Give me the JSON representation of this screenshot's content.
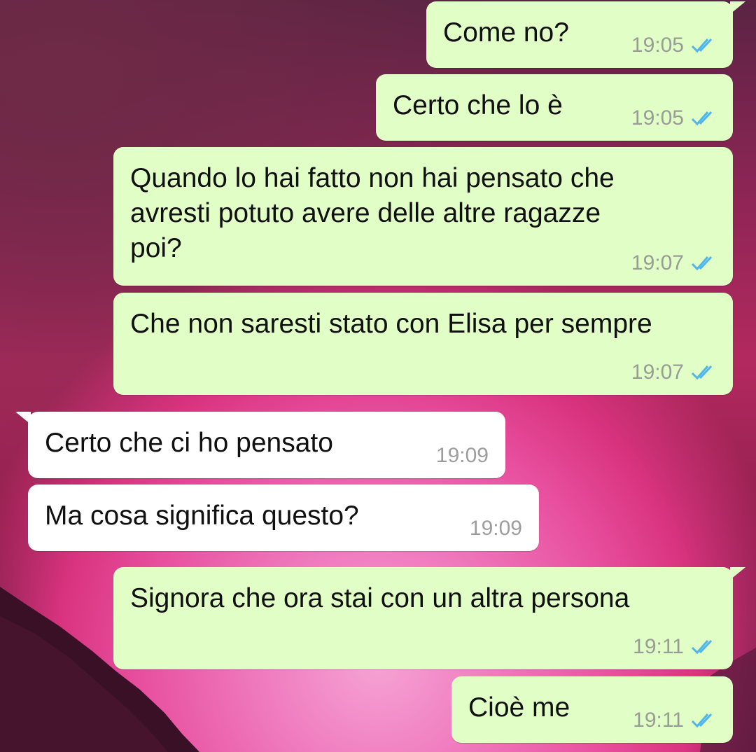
{
  "colors": {
    "outgoing_bubble": "#e1fec7",
    "incoming_bubble": "#ffffff",
    "read_ticks": "#4fb6ec",
    "time_text": "#979d95"
  },
  "messages": [
    {
      "direction": "outgoing",
      "text": "Come no?",
      "time": "19:05",
      "status_icon": "double-check-read-icon"
    },
    {
      "direction": "outgoing",
      "text": "Certo che lo è",
      "time": "19:05",
      "status_icon": "double-check-read-icon"
    },
    {
      "direction": "outgoing",
      "text": "Quando lo hai fatto non hai pensato che\navresti potuto avere delle altre ragazze\npoi?",
      "time": "19:07",
      "status_icon": "double-check-read-icon"
    },
    {
      "direction": "outgoing",
      "text": "Che non saresti stato con Elisa per sempre",
      "time": "19:07",
      "status_icon": "double-check-read-icon"
    },
    {
      "direction": "incoming",
      "text": "Certo che ci ho pensato",
      "time": "19:09"
    },
    {
      "direction": "incoming",
      "text": "Ma cosa significa questo?",
      "time": "19:09"
    },
    {
      "direction": "outgoing",
      "text": "Signora che ora stai con un altra persona",
      "time": "19:11",
      "status_icon": "double-check-read-icon"
    },
    {
      "direction": "outgoing",
      "text": "Cioè me",
      "time": "19:11",
      "status_icon": "double-check-read-icon"
    }
  ]
}
